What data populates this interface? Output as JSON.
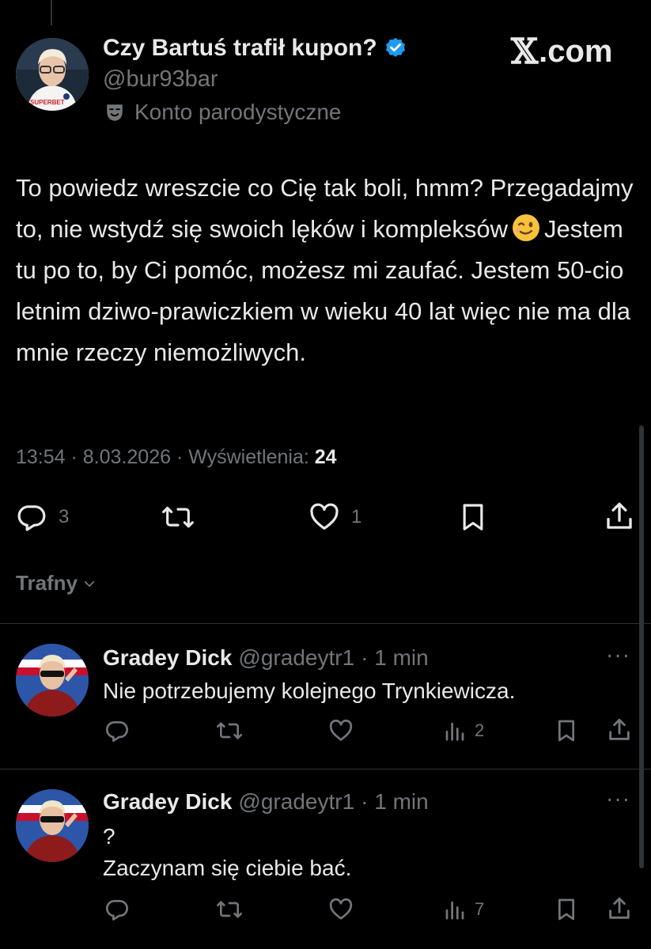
{
  "brand": {
    "x": "𝕏",
    "domain": ".com"
  },
  "author": {
    "name": "Czy Bartuś trafił kupon?",
    "handle": "@bur93bar",
    "parody_label": "Konto parodystyczne",
    "verified": true,
    "jersey_text": "SUPERBET"
  },
  "tweet": {
    "line1": "To powiedz wreszcie co Cię tak boli, hmm? Przegadajmy to, nie wstydź się swoich lęków i kompleksów",
    "emoji_name": "winking-face",
    "line2": "Jestem tu po to, by Ci pomóc, możesz mi zaufać. Jestem 50-cio letnim dziwo-prawiczkiem w wieku 40 lat więc nie ma dla mnie rzeczy niemożliwych.",
    "time": "13:54",
    "sep1": " · ",
    "date": "8.03.2026",
    "sep2": " · ",
    "views_label": "Wyświetlenia:",
    "views": "24"
  },
  "actions": {
    "replies": "3",
    "reposts": "",
    "likes": "1"
  },
  "sort": {
    "label": "Trafny"
  },
  "replies": [
    {
      "name": "Gradey Dick",
      "handle": "@gradeytr1",
      "time": "· 1 min",
      "text": "Nie potrzebujemy kolejnego Trynkiewicza.",
      "views": "2"
    },
    {
      "name": "Gradey Dick",
      "handle": "@gradeytr1",
      "time": "· 1 min",
      "text": "?\nZaczynam się ciebie bać.",
      "views": "7"
    }
  ],
  "colors": {
    "background": "#000000",
    "text": "#e7e9ea",
    "secondary": "#71767b",
    "verified_blue": "#1d9bf0",
    "divider": "#2f3336"
  }
}
